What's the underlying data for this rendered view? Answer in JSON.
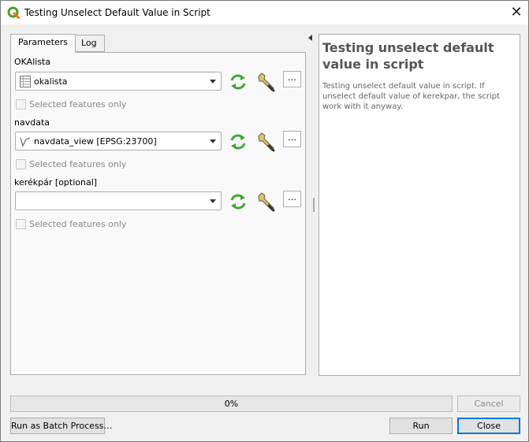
{
  "window": {
    "title": "Testing Unselect Default Value in Script",
    "close_glyph": "✕"
  },
  "tabs": [
    {
      "label": "Parameters",
      "active": true
    },
    {
      "label": "Log",
      "active": false
    }
  ],
  "params": [
    {
      "label": "OKAlista",
      "value": "okalista",
      "icon": "table-layer-icon",
      "more_label": "…",
      "checkbox_label": "Selected features only",
      "checked": false
    },
    {
      "label": "navdata",
      "value": "navdata_view [EPSG:23700]",
      "icon": "line-layer-icon",
      "more_label": "…",
      "checkbox_label": "Selected features only",
      "checked": false
    },
    {
      "label": "kerékpár [optional]",
      "value": "",
      "icon": "",
      "more_label": "…",
      "checkbox_label": "Selected features only",
      "checked": false
    }
  ],
  "help": {
    "title": "Testing unselect default value in script",
    "body": "Testing unselect default value in script. If unselect default value of kerekpar, the script work with it anyway."
  },
  "progress": {
    "value": 0,
    "text": "0%"
  },
  "buttons": {
    "cancel": "Cancel",
    "batch": "Run as Batch Process…",
    "run": "Run",
    "close": "Close"
  },
  "colors": {
    "accent": "#0078d7",
    "qgis_green": "#589632",
    "iterate_green": "#3fa535"
  }
}
